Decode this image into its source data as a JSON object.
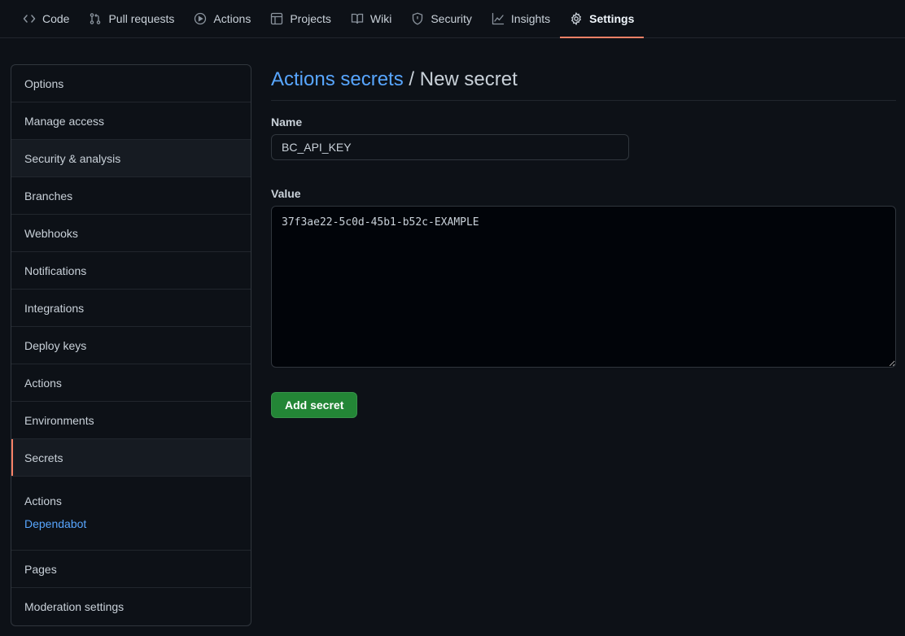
{
  "nav": {
    "tabs": [
      {
        "label": "Code",
        "icon": "code-icon"
      },
      {
        "label": "Pull requests",
        "icon": "git-pull-request-icon"
      },
      {
        "label": "Actions",
        "icon": "play-icon"
      },
      {
        "label": "Projects",
        "icon": "table-icon"
      },
      {
        "label": "Wiki",
        "icon": "book-icon"
      },
      {
        "label": "Security",
        "icon": "shield-icon"
      },
      {
        "label": "Insights",
        "icon": "graph-icon"
      },
      {
        "label": "Settings",
        "icon": "gear-icon"
      }
    ],
    "active": "Settings"
  },
  "sidebar": {
    "items": [
      {
        "label": "Options"
      },
      {
        "label": "Manage access"
      },
      {
        "label": "Security & analysis"
      },
      {
        "label": "Branches"
      },
      {
        "label": "Webhooks"
      },
      {
        "label": "Notifications"
      },
      {
        "label": "Integrations"
      },
      {
        "label": "Deploy keys"
      },
      {
        "label": "Actions"
      },
      {
        "label": "Environments"
      },
      {
        "label": "Secrets"
      }
    ],
    "selected": "Secrets",
    "sub": {
      "heading": "Actions",
      "link": "Dependabot"
    },
    "bottom_items": [
      {
        "label": "Pages"
      },
      {
        "label": "Moderation settings"
      }
    ]
  },
  "main": {
    "breadcrumb_link": "Actions secrets",
    "breadcrumb_separator": " / ",
    "breadcrumb_current": "New secret",
    "name_label": "Name",
    "name_value": "BC_API_KEY",
    "value_label": "Value",
    "value_text": "37f3ae22-5c0d-45b1-b52c-EXAMPLE",
    "submit_label": "Add secret"
  },
  "colors": {
    "background": "#0d1117",
    "accent_link": "#58a6ff",
    "active_underline": "#f78166",
    "button_green": "#238636"
  }
}
